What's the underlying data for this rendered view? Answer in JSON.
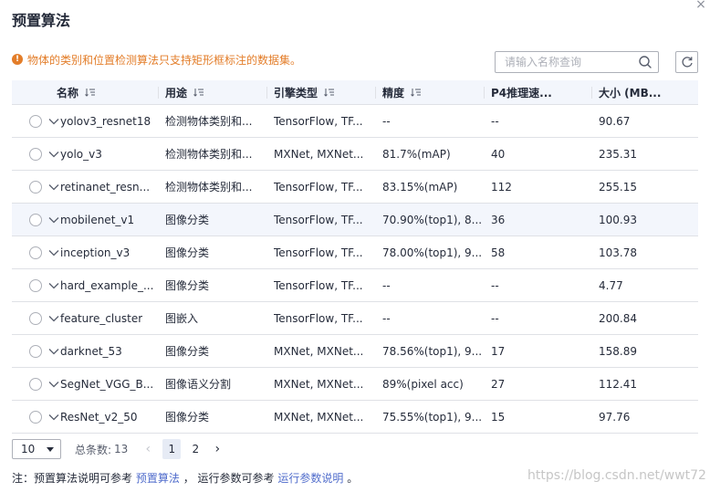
{
  "dialog": {
    "title": "预置算法",
    "close_icon": "close-icon"
  },
  "notice": {
    "text": "物体的类别和位置检测算法只支持矩形框标注的数据集。",
    "color": "#e37d29",
    "icon": "warning-icon"
  },
  "search": {
    "placeholder": "请输入名称查询",
    "value": "",
    "icon": "search-icon"
  },
  "refresh": {
    "icon": "refresh-icon"
  },
  "table": {
    "columns": [
      {
        "label": "名称",
        "sortable": true
      },
      {
        "label": "用途",
        "sortable": true
      },
      {
        "label": "引擎类型",
        "sortable": true
      },
      {
        "label": "精度",
        "sortable": true
      },
      {
        "label": "P4推理速...",
        "sortable": false
      },
      {
        "label": "大小 (MB...",
        "sortable": false
      }
    ],
    "rows": [
      {
        "name": "yolov3_resnet18",
        "use": "检测物体类别和...",
        "engine": "TensorFlow,  TF...",
        "accuracy": "--",
        "p4": "--",
        "size": "90.67"
      },
      {
        "name": "yolo_v3",
        "use": "检测物体类别和...",
        "engine": "MXNet,  MXNet...",
        "accuracy": "81.7%(mAP)",
        "p4": "40",
        "size": "235.31"
      },
      {
        "name": "retinanet_resn...",
        "use": "检测物体类别和...",
        "engine": "TensorFlow,  TF...",
        "accuracy": "83.15%(mAP)",
        "p4": "112",
        "size": "255.15"
      },
      {
        "name": "mobilenet_v1",
        "use": "图像分类",
        "engine": "TensorFlow,  TF...",
        "accuracy": "70.90%(top1), 8...",
        "p4": "36",
        "size": "100.93"
      },
      {
        "name": "inception_v3",
        "use": "图像分类",
        "engine": "TensorFlow,  TF...",
        "accuracy": "78.00%(top1), 9...",
        "p4": "58",
        "size": "103.78"
      },
      {
        "name": "hard_example_...",
        "use": "图像分类",
        "engine": "TensorFlow,  TF...",
        "accuracy": "--",
        "p4": "--",
        "size": "4.77"
      },
      {
        "name": "feature_cluster",
        "use": "图嵌入",
        "engine": "TensorFlow,  TF...",
        "accuracy": "--",
        "p4": "--",
        "size": "200.84"
      },
      {
        "name": "darknet_53",
        "use": "图像分类",
        "engine": "MXNet,  MXNet...",
        "accuracy": "78.56%(top1), 9...",
        "p4": "17",
        "size": "158.89"
      },
      {
        "name": "SegNet_VGG_B...",
        "use": "图像语义分割",
        "engine": "MXNet,  MXNet...",
        "accuracy": "89%(pixel acc)",
        "p4": "27",
        "size": "112.41"
      },
      {
        "name": "ResNet_v2_50",
        "use": "图像分类",
        "engine": "MXNet,  MXNet...",
        "accuracy": "75.55%(top1), 9...",
        "p4": "15",
        "size": "97.76"
      }
    ],
    "hover_row_index": 3
  },
  "pagination": {
    "page_size": "10",
    "total_label": "总条数:",
    "total_count": "13",
    "prev_icon": "chevron-left-icon",
    "next_icon": "chevron-right-icon",
    "pages": [
      "1",
      "2"
    ],
    "current_page": "1"
  },
  "footnote": {
    "prefix": "注：预置算法说明可参考",
    "link1": "预置算法",
    "middle": "，  运行参数可参考",
    "link2": "运行参数说明",
    "suffix": "。"
  },
  "watermark": "https://blog.csdn.net/wwt72",
  "colors": {
    "accent": "#526ecc",
    "warning": "#e37d29",
    "header_bg": "#f3f6fc",
    "border": "#dfe1e6"
  }
}
